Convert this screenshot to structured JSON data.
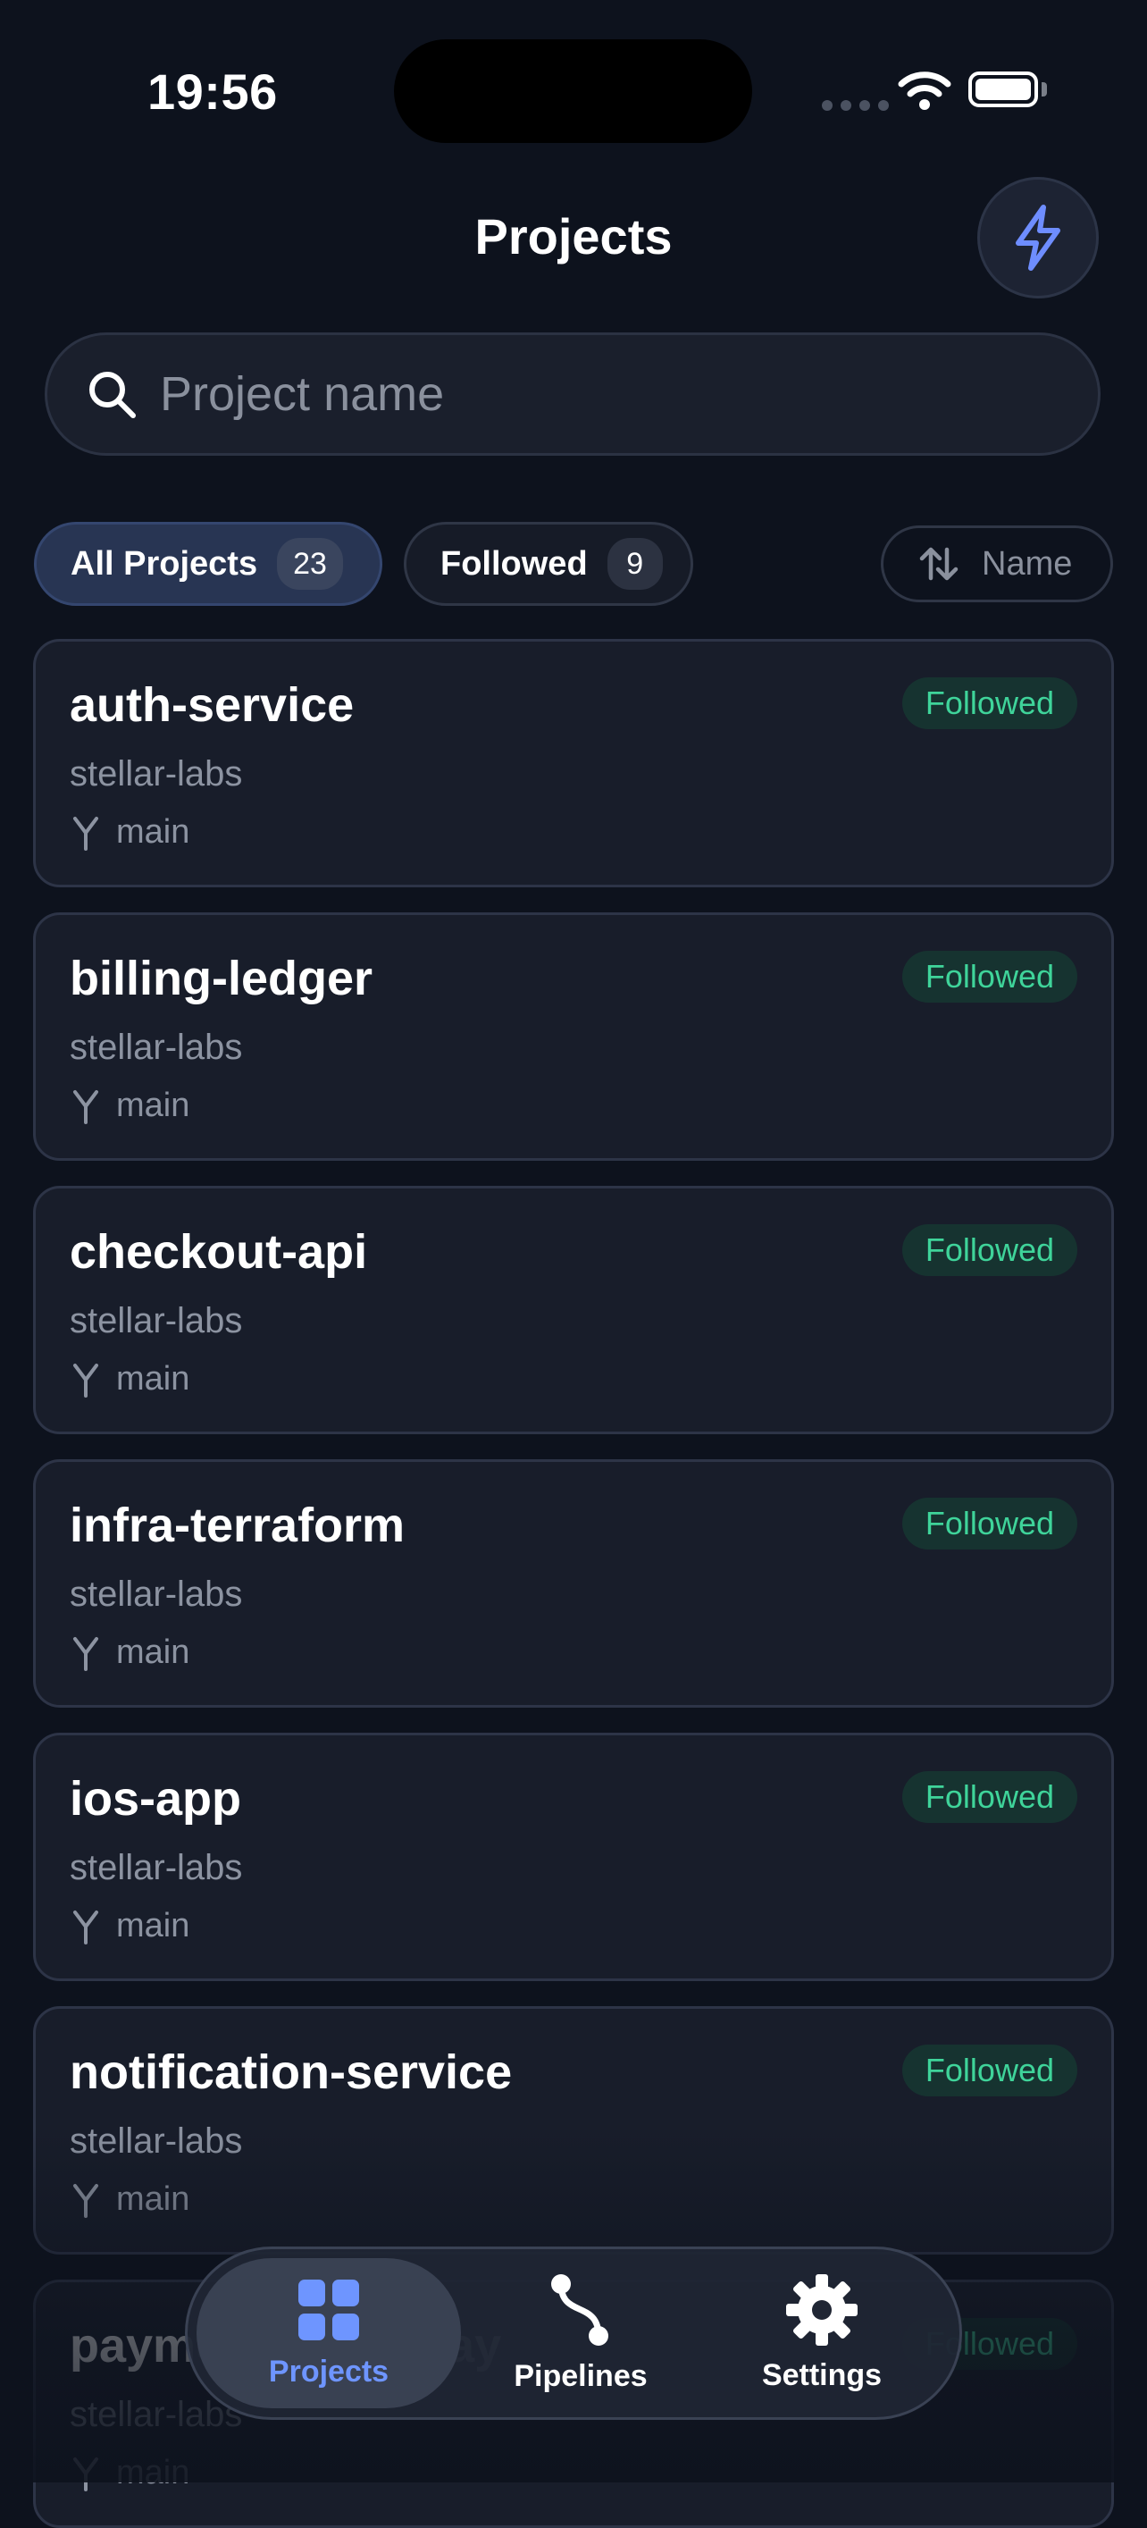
{
  "status_bar": {
    "time": "19:56"
  },
  "header": {
    "title": "Projects",
    "action_icon": "bolt-icon"
  },
  "search": {
    "placeholder": "Project name",
    "value": ""
  },
  "filters": {
    "all": {
      "label": "All Projects",
      "count": "23"
    },
    "followed": {
      "label": "Followed",
      "count": "9"
    },
    "sort": {
      "label": "Name",
      "icon": "sort-arrows-icon"
    }
  },
  "projects": [
    {
      "name": "auth-service",
      "org": "stellar-labs",
      "branch": "main",
      "badge": "Followed"
    },
    {
      "name": "billing-ledger",
      "org": "stellar-labs",
      "branch": "main",
      "badge": "Followed"
    },
    {
      "name": "checkout-api",
      "org": "stellar-labs",
      "branch": "main",
      "badge": "Followed"
    },
    {
      "name": "infra-terraform",
      "org": "stellar-labs",
      "branch": "main",
      "badge": "Followed"
    },
    {
      "name": "ios-app",
      "org": "stellar-labs",
      "branch": "main",
      "badge": "Followed"
    },
    {
      "name": "notification-service",
      "org": "stellar-labs",
      "branch": "main",
      "badge": "Followed"
    },
    {
      "name": "payments-gateway",
      "org": "stellar-labs",
      "branch": "main",
      "badge": "Followed"
    }
  ],
  "tabbar": {
    "projects": "Projects",
    "pipelines": "Pipelines",
    "settings": "Settings"
  },
  "colors": {
    "accent": "#6e95ff",
    "followed_badge_text": "#3fd49a",
    "background": "#0d121d"
  }
}
